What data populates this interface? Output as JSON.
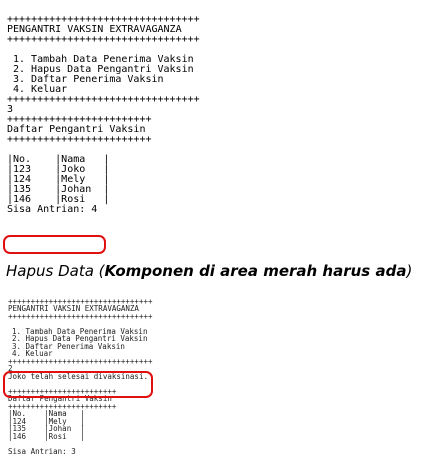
{
  "top": {
    "border": "++++++++++++++++++++++++++++++++",
    "title": "PENGANTRI VAKSIN EXTRAVAGANZA",
    "menu": [
      "1. Tambah Data Penerima Vaksin",
      "2. Hapus Data Pengantri Vaksin",
      "3. Daftar Penerima Vaksin",
      "4. Keluar"
    ],
    "input": "3",
    "list_border": "++++++++++++++++++++++++",
    "list_title": "Daftar Pengantri Vaksin",
    "table": [
      "|No.    |Nama   |",
      "|123    |Joko   |",
      "|124    |Mely   |",
      "|135    |Johan  |",
      "|146    |Rosi   |"
    ],
    "remaining": "Sisa Antrian: 4"
  },
  "caption": {
    "prefix": "Hapus Data (",
    "bold": "Komponen di area merah harus ada",
    "suffix": ")"
  },
  "bottom": {
    "border": "++++++++++++++++++++++++++++++++",
    "title": "PENGANTRI VAKSIN EXTRAVAGANZA",
    "menu": [
      "1. Tambah Data Penerima Vaksin",
      "2. Hapus Data Pengantri Vaksin",
      "3. Daftar Penerima Vaksin",
      "4. Keluar"
    ],
    "input": "2",
    "message": "Joko telah selesai divaksinasi.",
    "list_border": "++++++++++++++++++++++++",
    "list_title": "Daftar Pengantri Vaksin",
    "table": [
      "|No.    |Nama   |",
      "|124    |Mely   |",
      "|135    |Johan  |",
      "|146    |Rosi   |"
    ],
    "remaining": "Sisa Antrian: 3"
  },
  "colors": {
    "highlight": "#e01010"
  }
}
